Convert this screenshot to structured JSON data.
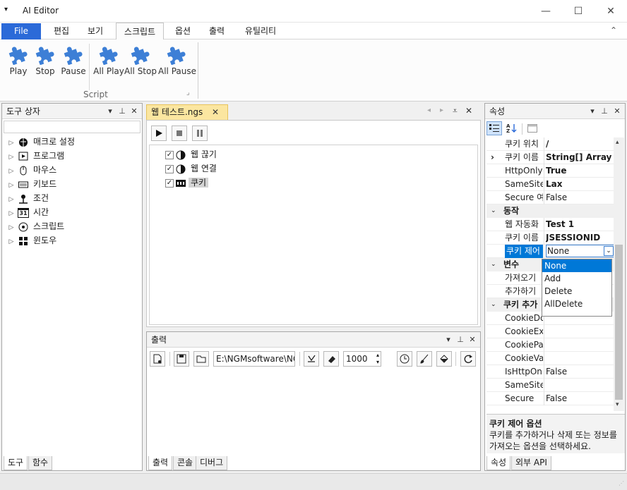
{
  "window": {
    "title": "AI Editor",
    "menu_glyph": "▾",
    "minimize": "—",
    "maximize": "☐",
    "close": "✕"
  },
  "menu": {
    "file": "File",
    "items": [
      "편집",
      "보기",
      "스크립트",
      "옵션",
      "출력",
      "유틸리티"
    ],
    "collapse": "⌃"
  },
  "ribbon": {
    "buttons": [
      {
        "label": "Play"
      },
      {
        "label": "Stop"
      },
      {
        "label": "Pause"
      },
      {
        "label": "All Play"
      },
      {
        "label": "All Stop"
      },
      {
        "label": "All Pause"
      }
    ],
    "group_label": "Script",
    "launcher": "⌟"
  },
  "toolbox": {
    "title": "도구 상자",
    "items": [
      "매크로 설정",
      "프로그램",
      "마우스",
      "키보드",
      "조건",
      "시간",
      "스크립트",
      "윈도우"
    ],
    "time_icon_text": "31",
    "tabs": [
      "도구",
      "함수"
    ]
  },
  "editor": {
    "tab_title": "웹 테스트.ngs",
    "tab_close": "✕",
    "nodes": [
      {
        "label": "웹 끊기"
      },
      {
        "label": "웹 연결"
      },
      {
        "label": "쿠키"
      }
    ],
    "check": "✓"
  },
  "output": {
    "title": "출력",
    "path": "E:\\NGMsoftware\\NG",
    "number": "1000",
    "tabs": [
      "출력",
      "콘솔",
      "디버그"
    ]
  },
  "properties": {
    "title": "속성",
    "rows": [
      {
        "name": "쿠키 위치",
        "value": "/",
        "bold": true
      },
      {
        "name": "쿠키 이름",
        "value": "String[] Array",
        "bold": true,
        "expand": "›"
      },
      {
        "name": "HttpOnly",
        "value": "True",
        "bold": true
      },
      {
        "name": "SameSite",
        "value": "Lax",
        "bold": true
      },
      {
        "name": "Secure 여부",
        "value": "False",
        "bold": false
      },
      {
        "category": "동작"
      },
      {
        "name": "웹 자동화",
        "value": "Test 1",
        "bold": true
      },
      {
        "name": "쿠키 이름",
        "value": "JSESSIONID",
        "bold": true
      },
      {
        "name": "쿠키 제어",
        "value": "None",
        "bold": false,
        "selected": true
      },
      {
        "category": "변수"
      },
      {
        "name": "가져오기",
        "value": "",
        "bold": false
      },
      {
        "name": "추가하기",
        "value": "",
        "bold": false
      },
      {
        "category": "쿠키 추가"
      },
      {
        "name": "CookieDomain",
        "value": "",
        "bold": false
      },
      {
        "name": "CookieExpires",
        "value": "",
        "bold": false
      },
      {
        "name": "CookiePath",
        "value": "",
        "bold": false
      },
      {
        "name": "CookieValue",
        "value": "",
        "bold": false
      },
      {
        "name": "IsHttpOnly",
        "value": "False",
        "bold": false
      },
      {
        "name": "SameSite",
        "value": "",
        "bold": false
      },
      {
        "name": "Secure",
        "value": "False",
        "bold": false
      }
    ],
    "dropdown": {
      "options": [
        "None",
        "Add",
        "Delete",
        "AllDelete"
      ],
      "selected": "None"
    },
    "description": {
      "title": "쿠키 제어 옵션",
      "text": "쿠키를 추가하거나 삭제 또는 정보를 가져오는 옵션을 선택하세요."
    },
    "tabs": [
      "속성",
      "외부 API"
    ]
  },
  "colors": {
    "accent": "#2b6ad8",
    "puzzle": "#3d7fd6",
    "tab_highlight": "#fbe6a0",
    "selection": "#0078d7"
  }
}
